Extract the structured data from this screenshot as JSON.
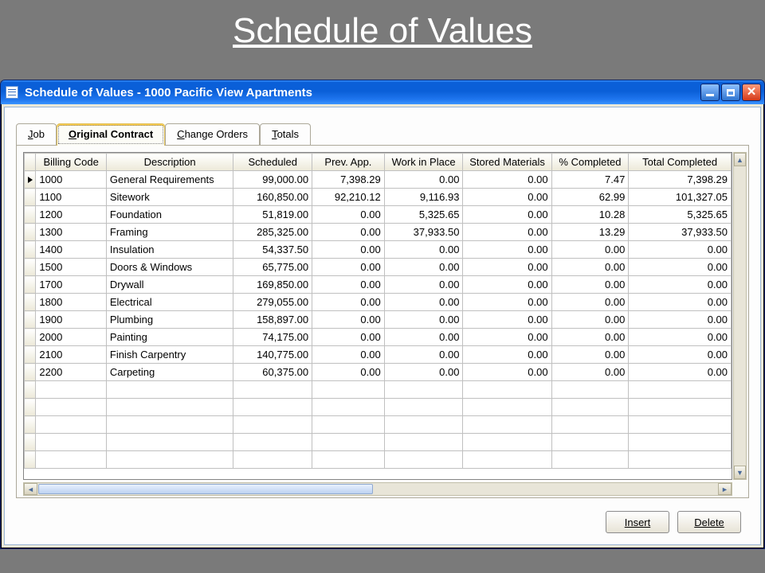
{
  "page_heading": "Schedule of Values",
  "window": {
    "title": "Schedule of Values - 1000   Pacific View Apartments"
  },
  "tabs": [
    {
      "label": "Job",
      "underline_pos": 0
    },
    {
      "label": "Original Contract",
      "underline_pos": 0,
      "active": true
    },
    {
      "label": "Change Orders",
      "underline_pos": 0
    },
    {
      "label": "Totals",
      "underline_pos": 0
    }
  ],
  "grid": {
    "columns": [
      "Billing Code",
      "Description",
      "Scheduled",
      "Prev. App.",
      "Work in Place",
      "Stored Materials",
      "% Completed",
      "Total Completed"
    ],
    "rows": [
      {
        "code": "1000",
        "desc": "General Requirements",
        "sched": "99,000.00",
        "prev": "7,398.29",
        "wip": "0.00",
        "stor": "0.00",
        "pct": "7.47",
        "tot": "7,398.29",
        "current": true
      },
      {
        "code": "1100",
        "desc": "Sitework",
        "sched": "160,850.00",
        "prev": "92,210.12",
        "wip": "9,116.93",
        "stor": "0.00",
        "pct": "62.99",
        "tot": "101,327.05"
      },
      {
        "code": "1200",
        "desc": "Foundation",
        "sched": "51,819.00",
        "prev": "0.00",
        "wip": "5,325.65",
        "stor": "0.00",
        "pct": "10.28",
        "tot": "5,325.65"
      },
      {
        "code": "1300",
        "desc": "Framing",
        "sched": "285,325.00",
        "prev": "0.00",
        "wip": "37,933.50",
        "stor": "0.00",
        "pct": "13.29",
        "tot": "37,933.50"
      },
      {
        "code": "1400",
        "desc": "Insulation",
        "sched": "54,337.50",
        "prev": "0.00",
        "wip": "0.00",
        "stor": "0.00",
        "pct": "0.00",
        "tot": "0.00"
      },
      {
        "code": "1500",
        "desc": "Doors & Windows",
        "sched": "65,775.00",
        "prev": "0.00",
        "wip": "0.00",
        "stor": "0.00",
        "pct": "0.00",
        "tot": "0.00"
      },
      {
        "code": "1700",
        "desc": "Drywall",
        "sched": "169,850.00",
        "prev": "0.00",
        "wip": "0.00",
        "stor": "0.00",
        "pct": "0.00",
        "tot": "0.00"
      },
      {
        "code": "1800",
        "desc": "Electrical",
        "sched": "279,055.00",
        "prev": "0.00",
        "wip": "0.00",
        "stor": "0.00",
        "pct": "0.00",
        "tot": "0.00"
      },
      {
        "code": "1900",
        "desc": "Plumbing",
        "sched": "158,897.00",
        "prev": "0.00",
        "wip": "0.00",
        "stor": "0.00",
        "pct": "0.00",
        "tot": "0.00"
      },
      {
        "code": "2000",
        "desc": "Painting",
        "sched": "74,175.00",
        "prev": "0.00",
        "wip": "0.00",
        "stor": "0.00",
        "pct": "0.00",
        "tot": "0.00"
      },
      {
        "code": "2100",
        "desc": "Finish Carpentry",
        "sched": "140,775.00",
        "prev": "0.00",
        "wip": "0.00",
        "stor": "0.00",
        "pct": "0.00",
        "tot": "0.00"
      },
      {
        "code": "2200",
        "desc": "Carpeting",
        "sched": "60,375.00",
        "prev": "0.00",
        "wip": "0.00",
        "stor": "0.00",
        "pct": "0.00",
        "tot": "0.00"
      }
    ],
    "blank_rows": 5
  },
  "buttons": {
    "insert": "Insert",
    "delete": "Delete"
  }
}
